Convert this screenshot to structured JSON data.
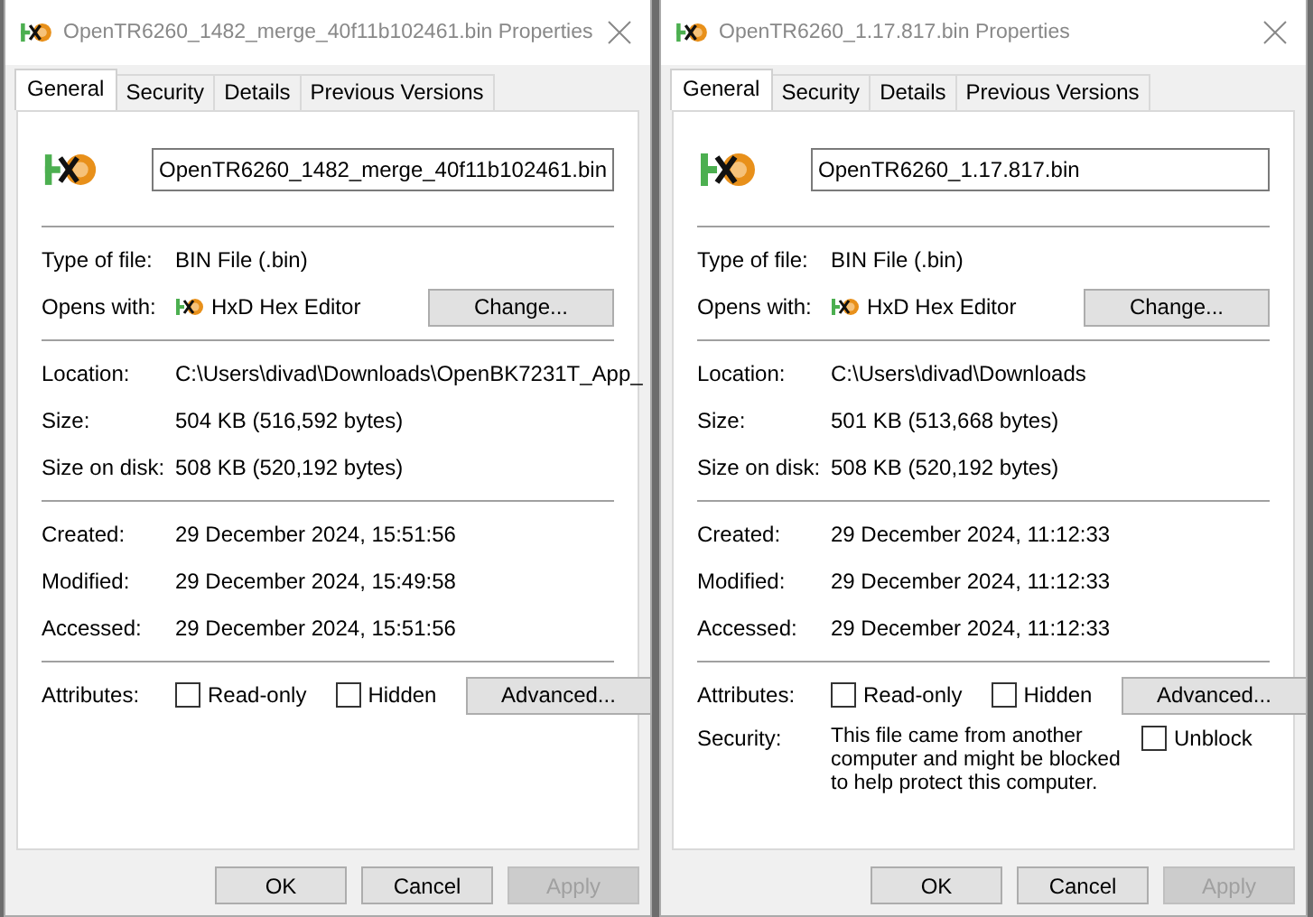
{
  "dialogs": [
    {
      "title": "OpenTR6260_1482_merge_40f11b102461.bin Properties",
      "tabs": [
        {
          "label": "General",
          "selected": true
        },
        {
          "label": "Security",
          "selected": false
        },
        {
          "label": "Details",
          "selected": false
        },
        {
          "label": "Previous Versions",
          "selected": false
        }
      ],
      "filename": "OpenTR6260_1482_merge_40f11b102461.bin",
      "sections": [
        [
          {
            "kind": "text",
            "label": "Type of file:",
            "value": "BIN File (.bin)"
          },
          {
            "kind": "opens_with",
            "label": "Opens with:",
            "value": "HxD Hex Editor",
            "button": "Change..."
          }
        ],
        [
          {
            "kind": "text",
            "label": "Location:",
            "value": "C:\\Users\\divad\\Downloads\\OpenBK7231T_App_"
          },
          {
            "kind": "text",
            "label": "Size:",
            "value": "504 KB (516,592 bytes)"
          },
          {
            "kind": "text",
            "label": "Size on disk:",
            "value": "508 KB (520,192 bytes)"
          }
        ],
        [
          {
            "kind": "text",
            "label": "Created:",
            "value": "29 December 2024, 15:51:56"
          },
          {
            "kind": "text",
            "label": "Modified:",
            "value": "29 December 2024, 15:49:58"
          },
          {
            "kind": "text",
            "label": "Accessed:",
            "value": "29 December 2024, 15:51:56"
          }
        ]
      ],
      "attributes": {
        "label": "Attributes:",
        "checkboxes": [
          {
            "label": "Read-only",
            "checked": false
          },
          {
            "label": "Hidden",
            "checked": false
          }
        ],
        "button": "Advanced..."
      },
      "buttons": [
        {
          "label": "OK",
          "disabled": false
        },
        {
          "label": "Cancel",
          "disabled": false
        },
        {
          "label": "Apply",
          "disabled": true
        }
      ]
    },
    {
      "title": "OpenTR6260_1.17.817.bin Properties",
      "tabs": [
        {
          "label": "General",
          "selected": true
        },
        {
          "label": "Security",
          "selected": false
        },
        {
          "label": "Details",
          "selected": false
        },
        {
          "label": "Previous Versions",
          "selected": false
        }
      ],
      "filename": "OpenTR6260_1.17.817.bin",
      "sections": [
        [
          {
            "kind": "text",
            "label": "Type of file:",
            "value": "BIN File (.bin)"
          },
          {
            "kind": "opens_with",
            "label": "Opens with:",
            "value": "HxD Hex Editor",
            "button": "Change..."
          }
        ],
        [
          {
            "kind": "text",
            "label": "Location:",
            "value": "C:\\Users\\divad\\Downloads"
          },
          {
            "kind": "text",
            "label": "Size:",
            "value": "501 KB (513,668 bytes)"
          },
          {
            "kind": "text",
            "label": "Size on disk:",
            "value": "508 KB (520,192 bytes)"
          }
        ],
        [
          {
            "kind": "text",
            "label": "Created:",
            "value": "29 December 2024, 11:12:33"
          },
          {
            "kind": "text",
            "label": "Modified:",
            "value": "29 December 2024, 11:12:33"
          },
          {
            "kind": "text",
            "label": "Accessed:",
            "value": "29 December 2024, 11:12:33"
          }
        ]
      ],
      "attributes": {
        "label": "Attributes:",
        "checkboxes": [
          {
            "label": "Read-only",
            "checked": false
          },
          {
            "label": "Hidden",
            "checked": false
          }
        ],
        "button": "Advanced..."
      },
      "security": {
        "label": "Security:",
        "text": "This file came from another computer and might be blocked to help protect this computer.",
        "checkbox": {
          "label": "Unblock",
          "checked": false
        }
      },
      "buttons": [
        {
          "label": "OK",
          "disabled": false
        },
        {
          "label": "Cancel",
          "disabled": false
        },
        {
          "label": "Apply",
          "disabled": true
        }
      ]
    }
  ]
}
